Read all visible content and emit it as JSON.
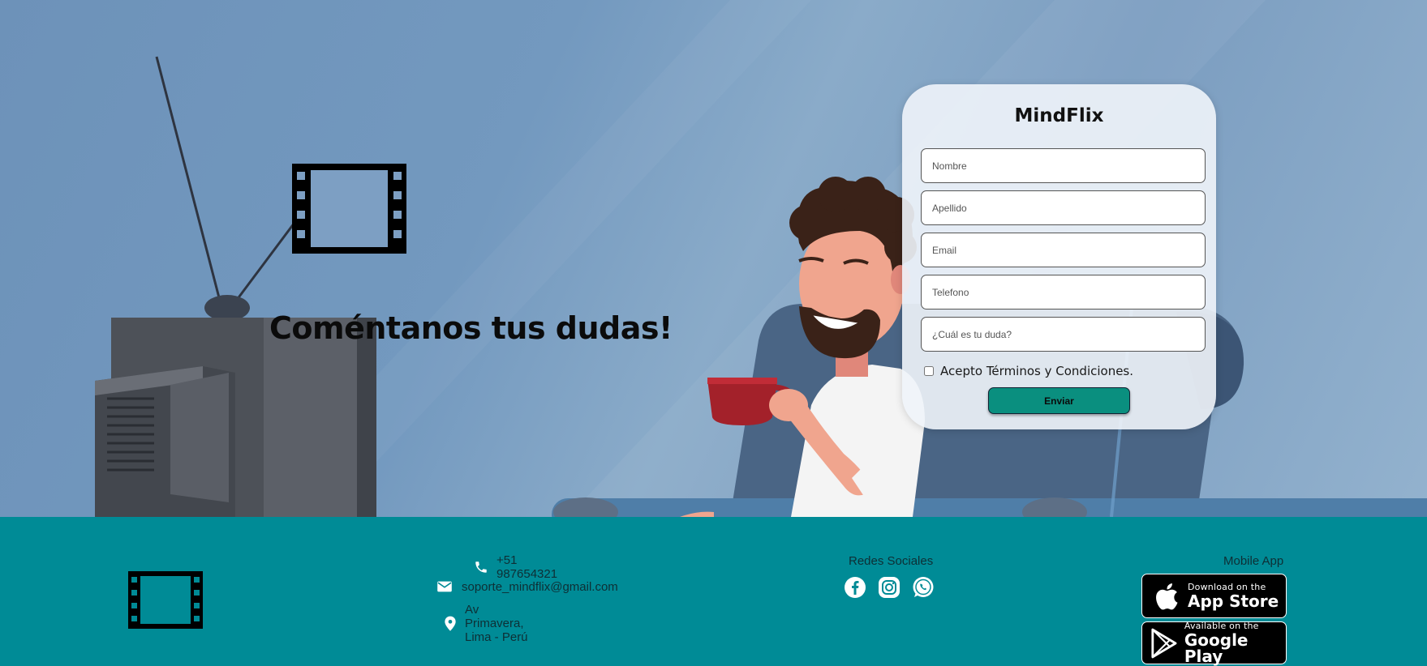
{
  "hero": {
    "title": "Coméntanos tus dudas!"
  },
  "form": {
    "brand": "MindFlix",
    "fields": [
      {
        "placeholder": "Nombre"
      },
      {
        "placeholder": "Apellido"
      },
      {
        "placeholder": "Email"
      },
      {
        "placeholder": "Telefono"
      },
      {
        "placeholder": "¿Cuál es tu duda?"
      }
    ],
    "terms_label": "Acepto Términos y Condiciones.",
    "submit_label": "Enviar"
  },
  "footer": {
    "contact": {
      "phone": "+51 987654321",
      "email": "soporte_mindflix@gmail.com",
      "address": "Av Primavera, Lima - Perú"
    },
    "social": {
      "title": "Redes Sociales",
      "icons": [
        "facebook-icon",
        "instagram-icon",
        "whatsapp-icon"
      ]
    },
    "mobile": {
      "title": "Mobile App",
      "app_store_small": "Download on the",
      "app_store_big": "App Store",
      "google_play_small": "Available on the",
      "google_play_big": "Google Play"
    }
  },
  "colors": {
    "footer_bg": "#008b96",
    "submit_bg": "#0a8f7f",
    "card_bg": "#eef2f8"
  }
}
